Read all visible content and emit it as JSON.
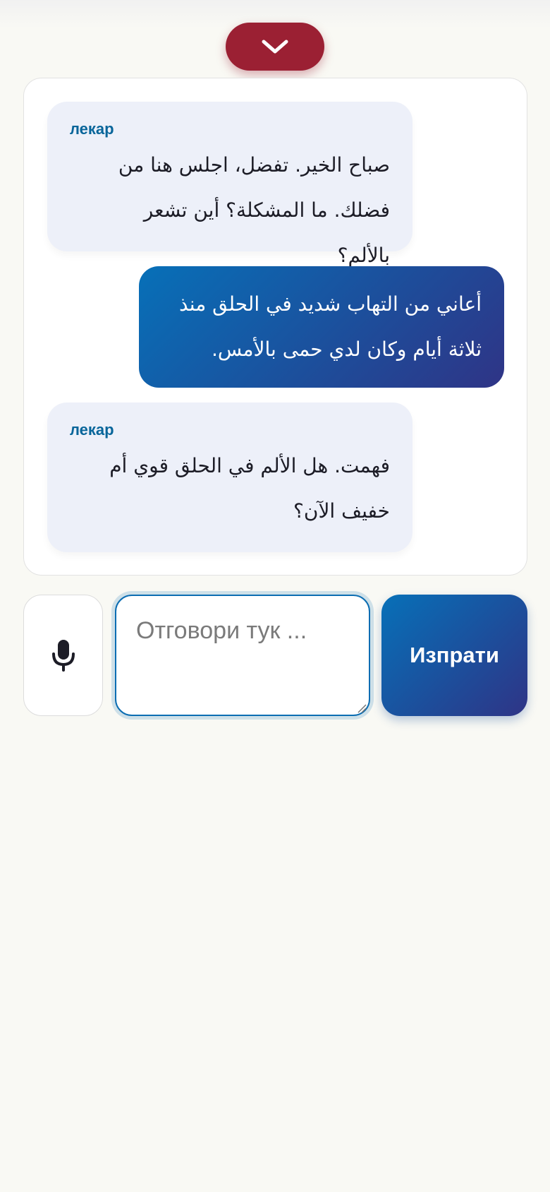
{
  "header": {
    "collapse_icon": "chevron-down-icon",
    "accent": "#9b2033"
  },
  "chat": {
    "messages": [
      {
        "role": "doctor",
        "sender": "лекар",
        "text": "صباح الخير. تفضل، اجلس هنا من فضلك. ما المشكلة؟ أين تشعر بالألم؟"
      },
      {
        "role": "user",
        "sender": "",
        "text": "أعاني من التهاب شديد في الحلق منذ ثلاثة أيام وكان لدي حمى بالأمس."
      },
      {
        "role": "doctor",
        "sender": "лекар",
        "text": "فهمت. هل الألم في الحلق قوي أم خفيف الآن؟"
      }
    ]
  },
  "composer": {
    "mic_icon": "microphone-icon",
    "placeholder": "Отговори тук ...",
    "value": "",
    "send_label": "Изпрати"
  },
  "colors": {
    "sender_label": "#07659a",
    "doctor_bubble": "#edf0f9",
    "user_bubble_start": "#0770b8",
    "user_bubble_end": "#2f3486"
  }
}
